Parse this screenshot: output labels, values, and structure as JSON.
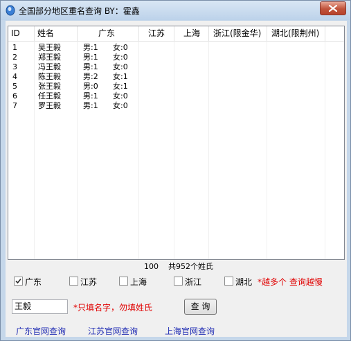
{
  "window": {
    "title": "全国部分地区重名查询     BY：霍鑫",
    "icon": "app-icon",
    "close": "close-icon"
  },
  "table": {
    "headers": [
      "ID",
      "姓名",
      "广东",
      "江苏",
      "上海",
      "浙江(限金华)",
      "湖北(限荆州)"
    ],
    "rows": [
      {
        "id": "1",
        "name": "吴王毅",
        "male": "男:1",
        "female": "女:0"
      },
      {
        "id": "2",
        "name": "郑王毅",
        "male": "男:1",
        "female": "女:0"
      },
      {
        "id": "3",
        "name": "冯王毅",
        "male": "男:1",
        "female": "女:0"
      },
      {
        "id": "4",
        "name": "陈王毅",
        "male": "男:2",
        "female": "女:1"
      },
      {
        "id": "5",
        "name": "张王毅",
        "male": "男:0",
        "female": "女:1"
      },
      {
        "id": "6",
        "name": "任王毅",
        "male": "男:1",
        "female": "女:0"
      },
      {
        "id": "7",
        "name": "罗王毅",
        "male": "男:1",
        "female": "女:0"
      }
    ]
  },
  "status": {
    "progress": "100",
    "total": "共952个姓氏"
  },
  "provinces": [
    {
      "label": "广东",
      "checked": true
    },
    {
      "label": "江苏",
      "checked": false
    },
    {
      "label": "上海",
      "checked": false
    },
    {
      "label": "浙江",
      "checked": false
    },
    {
      "label": "湖北",
      "checked": false
    }
  ],
  "warning": "*越多个  查询越慢",
  "search": {
    "value": "王毅",
    "hint": "*只填名字，勿填姓氏",
    "button": "查 询"
  },
  "links": [
    "广东官网查询",
    "江苏官网查询",
    "上海官网查询"
  ],
  "colors": {
    "accent_red": "#e00000",
    "link_blue": "#1f2bb3",
    "frame_blue": "#c5d7ea"
  }
}
